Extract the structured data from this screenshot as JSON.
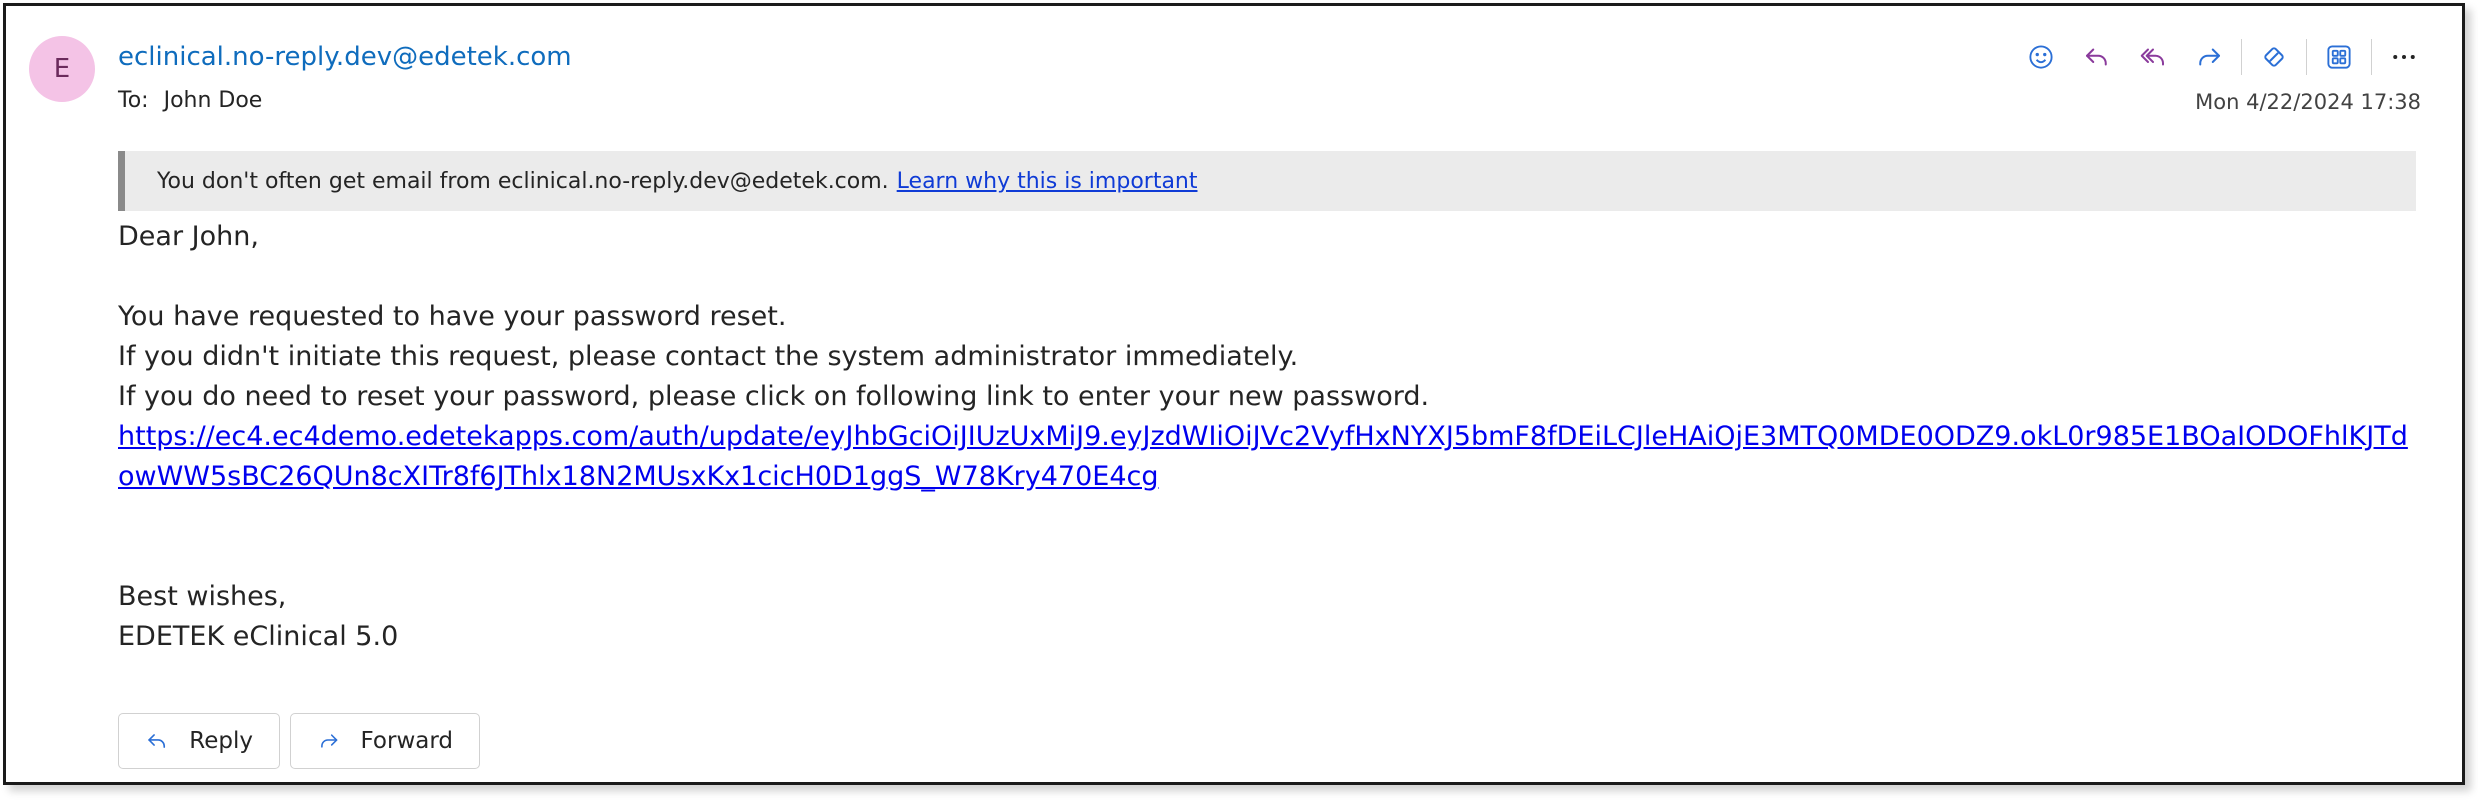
{
  "message": {
    "sender_initial": "E",
    "sender_email": "eclinical.no-reply.dev@edetek.com",
    "to_label": "To:",
    "to_name": "John Doe",
    "timestamp": "Mon 4/22/2024 17:38"
  },
  "toolbar": {
    "icons": [
      "emoji-react-icon",
      "reply-icon",
      "reply-all-icon",
      "forward-icon",
      "loop-icon",
      "apps-icon",
      "more-icon"
    ],
    "reply_color": "#8a3b9c",
    "forward_color": "#2b6fd6"
  },
  "banner": {
    "text": "You don't often get email from eclinical.no-reply.dev@edetek.com.",
    "link_text": "Learn why this is important"
  },
  "body": {
    "greeting": "Dear John,",
    "line1": "You have requested to have your password reset.",
    "line2": "If you didn't initiate this request, please contact the system administrator immediately.",
    "line3": "If you do need to reset your password, please click on following link to enter your new password.",
    "link": "https://ec4.ec4demo.edetekapps.com/auth/update/eyJhbGciOiJIUzUxMiJ9.eyJzdWIiOiJVc2VyfHxNYXJ5bmF8fDEiLCJleHAiOjE3MTQ0MDE0ODZ9.okL0r985E1BOaIODOFhlKJTdowWW5sBC26QUn8cXITr8f6JThlx18N2MUsxKx1cicH0D1ggS_W78Kry470E4cg",
    "closing": "Best wishes,",
    "signature": "EDETEK eClinical 5.0"
  },
  "actions": {
    "reply_label": "Reply",
    "forward_label": "Forward"
  },
  "colors": {
    "accent": "#0f6cbd",
    "avatar_bg": "#f4c3e6",
    "link": "#0000ee",
    "banner_bg": "#ebebeb"
  }
}
